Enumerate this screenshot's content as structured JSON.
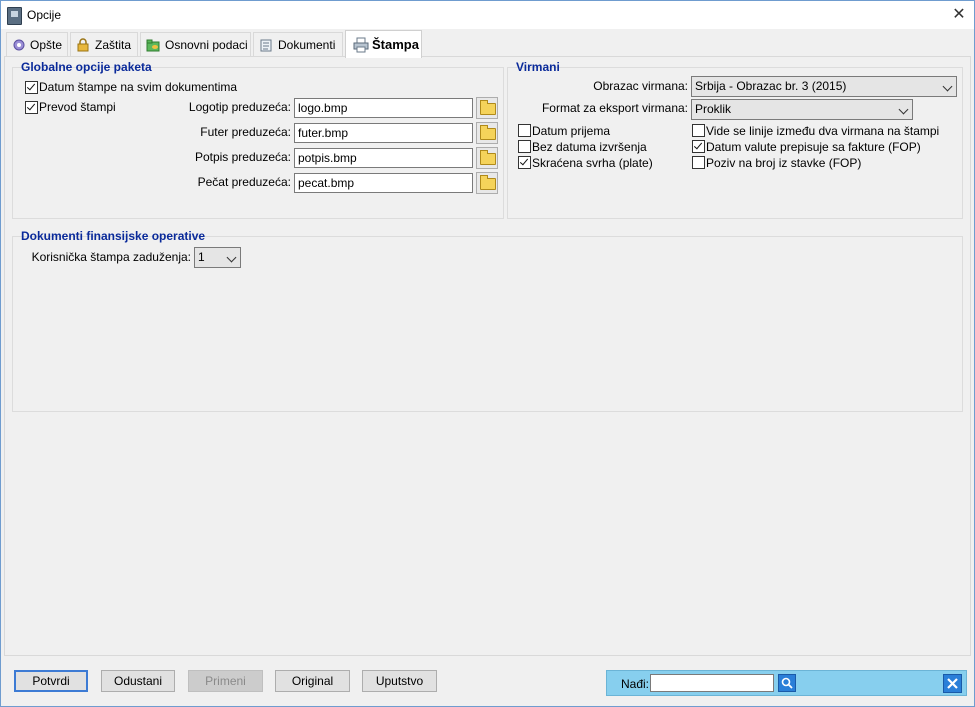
{
  "window": {
    "title": "Opcije"
  },
  "tabs": [
    {
      "label": "Opšte"
    },
    {
      "label": "Zaštita"
    },
    {
      "label": "Osnovni podaci"
    },
    {
      "label": "Dokumenti"
    },
    {
      "label": "Štampa",
      "active": true
    }
  ],
  "global": {
    "title": "Globalne opcije paketa",
    "datum_stampe": {
      "label": "Datum štampe na svim dokumentima",
      "checked": true
    },
    "prevod": {
      "label": "Prevod štampi",
      "checked": true
    },
    "logo": {
      "label": "Logotip preduzeća:",
      "value": "logo.bmp"
    },
    "futer": {
      "label": "Futer preduzeća:",
      "value": "futer.bmp"
    },
    "potpis": {
      "label": "Potpis preduzeća:",
      "value": "potpis.bmp"
    },
    "pecat": {
      "label": "Pečat preduzeća:",
      "value": "pecat.bmp"
    }
  },
  "virmani": {
    "title": "Virmani",
    "obrazac_label": "Obrazac virmana:",
    "obrazac_value": "Srbija - Obrazac br. 3 (2015)",
    "format_label": "Format za eksport virmana:",
    "format_value": "Proklik",
    "checks": [
      {
        "label": "Datum prijema",
        "checked": false
      },
      {
        "label": "Bez datuma izvršenja",
        "checked": false
      },
      {
        "label": "Skraćena svrha (plate)",
        "checked": true
      },
      {
        "label": "Vide se linije između dva virmana na štampi",
        "checked": false
      },
      {
        "label": "Datum valute prepisuje sa fakture (FOP)",
        "checked": true
      },
      {
        "label": "Poziv na broj iz stavke (FOP)",
        "checked": false
      }
    ]
  },
  "finansije": {
    "title": "Dokumenti finansijske operative",
    "label": "Korisnička štampa zaduženja:",
    "value": "1"
  },
  "buttons": {
    "potvrdi": "Potvrdi",
    "odustani": "Odustani",
    "primeni": "Primeni",
    "original": "Original",
    "uputstvo": "Uputstvo"
  },
  "find": {
    "label": "Nađi:",
    "value": ""
  },
  "colors": {
    "group_title": "#0a2a9a",
    "find_bar": "#87cfee",
    "primary_border": "#3d7bd4"
  },
  "icons": [
    "app-icon",
    "gear-icon",
    "lock-icon",
    "folder-database-icon",
    "document-icon",
    "printer-icon",
    "folder-icon",
    "search-icon",
    "close-icon",
    "chevron-down-icon",
    "checkmark-icon"
  ]
}
